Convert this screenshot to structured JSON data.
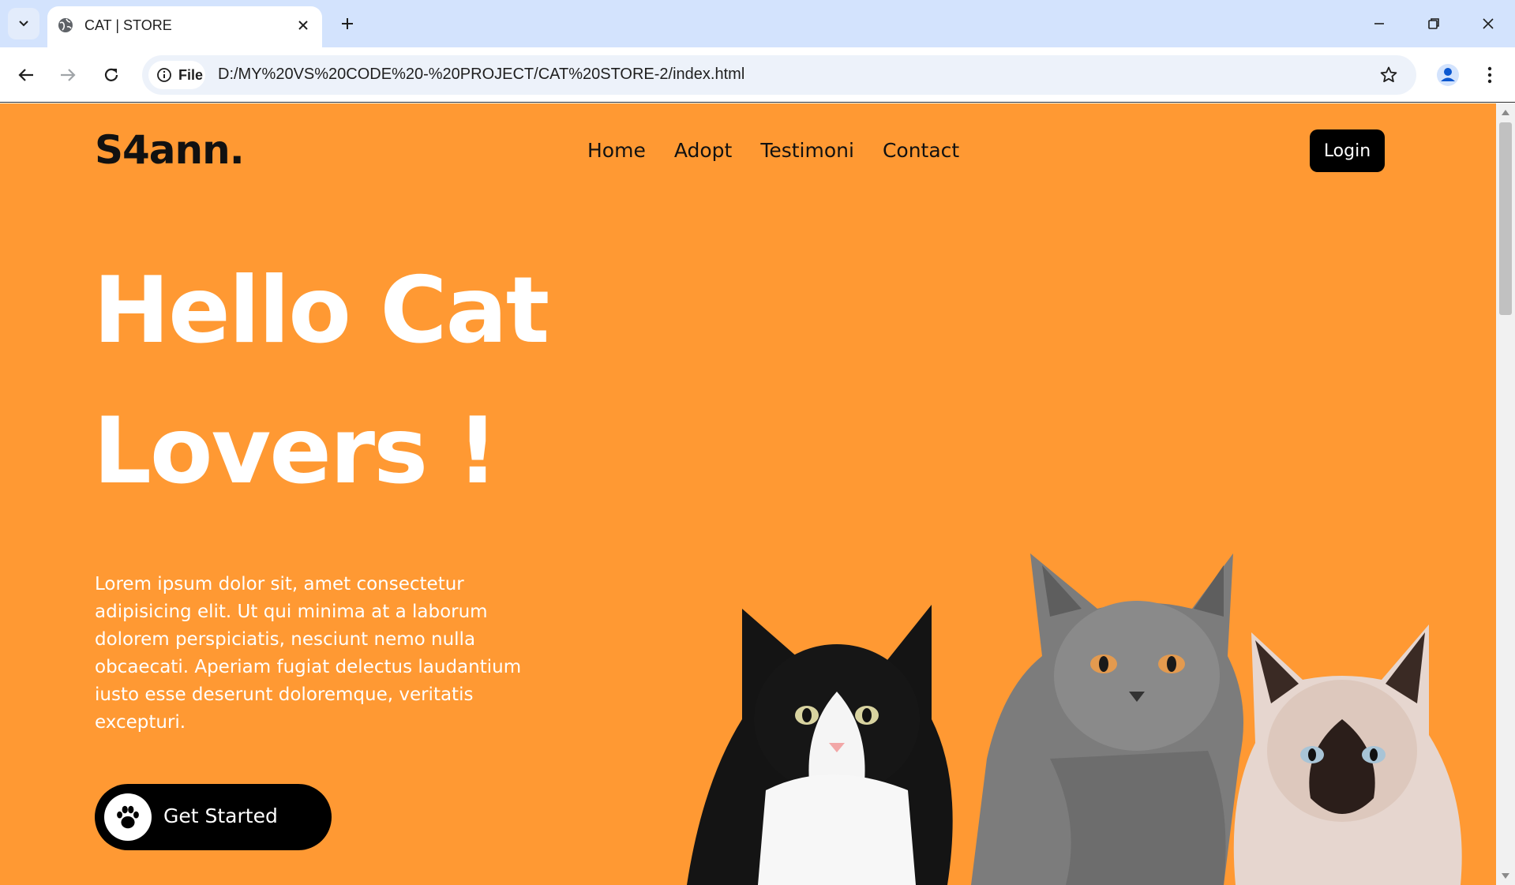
{
  "browser": {
    "tab_title": "CAT | STORE",
    "site_chip_label": "File",
    "url": "D:/MY%20VS%20CODE%20-%20PROJECT/CAT%20STORE-2/index.html",
    "icons": [
      "tab-list-icon",
      "globe-icon",
      "close-icon",
      "plus-icon",
      "minimize-icon",
      "restore-icon",
      "window-close-icon",
      "back-icon",
      "forward-icon",
      "reload-icon",
      "info-icon",
      "star-icon",
      "profile-icon",
      "more-vert-icon"
    ]
  },
  "page": {
    "brand": "S4ann.",
    "nav": [
      "Home",
      "Adopt",
      "Testimoni",
      "Contact"
    ],
    "login_label": "Login",
    "hero_line1": "Hello Cat",
    "hero_line2": "Lovers !",
    "description": "Lorem ipsum dolor sit, amet consectetur adipisicing elit. Ut qui minima at a laborum dolorem perspiciatis, nesciunt nemo nulla obcaecati. Aperiam fugiat delectus laudantium iusto esse deserunt doloremque, veritatis excepturi.",
    "cta_label": "Get Started",
    "cta_icon": "paw-icon",
    "hero_image": "three-cats-illustration"
  },
  "colors": {
    "page_bg": "#ff9933",
    "chrome_tabstrip": "#d3e3fd",
    "omnibox": "#edf2fa",
    "button_bg": "#000000",
    "hero_text": "#ffffff"
  }
}
